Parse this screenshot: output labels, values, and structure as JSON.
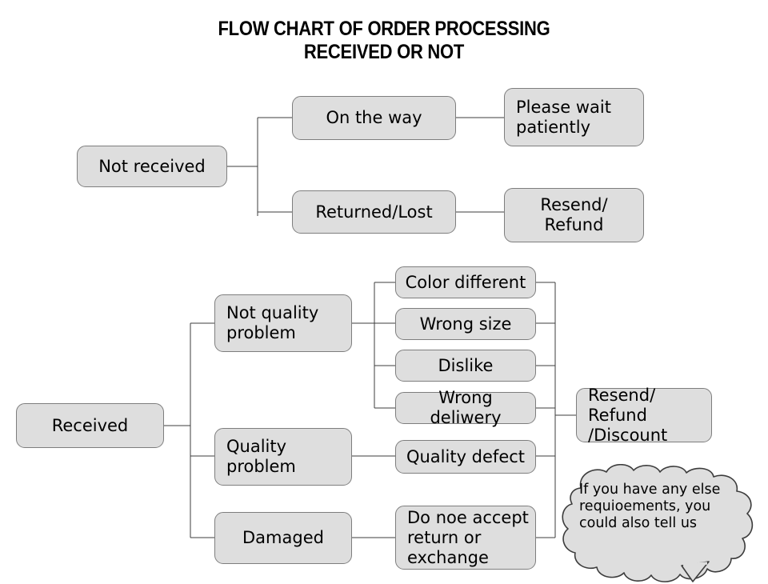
{
  "title": "FLOW CHART OF ORDER PROCESSING\nRECEIVED OR NOT",
  "colors": {
    "node_fill": "#dedede",
    "node_border": "#7e7e7e",
    "line": "#3c3c3c",
    "text": "#000000",
    "background": "#ffffff"
  },
  "chart_data": {
    "type": "diagram",
    "title": "FLOW CHART OF ORDER PROCESSING RECEIVED OR NOT",
    "diagram_kind": "flowchart-tree",
    "orientation": "left-to-right",
    "trees": [
      {
        "root": "Not received",
        "branches": [
          {
            "condition": "On the way",
            "outcome": "Please wait\npatiently"
          },
          {
            "condition": "Returned/Lost",
            "outcome": "Resend/\nRefund"
          }
        ]
      },
      {
        "root": "Received",
        "branches": [
          {
            "condition": "Not quality\nproblem",
            "reasons": [
              "Color different",
              "Wrong size",
              "Dislike",
              "Wrong deliwery"
            ],
            "outcome": "Resend/ Refund\n/Discount"
          },
          {
            "condition": "Quality\nproblem",
            "reasons": [
              "Quality defect"
            ],
            "outcome": "Resend/ Refund\n/Discount"
          },
          {
            "condition": "Damaged",
            "reasons": [
              "Do noe accept\nreturn or\nexchange"
            ],
            "outcome": "Resend/ Refund\n/Discount"
          }
        ]
      }
    ],
    "annotation": "If you have any else\nrequioements, you\ncould also tell us"
  },
  "nodes": {
    "not_received": {
      "label": "Not received"
    },
    "on_the_way": {
      "label": "On the way"
    },
    "please_wait": {
      "label": "Please wait\npatiently"
    },
    "returned_lost": {
      "label": "Returned/Lost"
    },
    "resend_refund": {
      "label": "Resend/\nRefund"
    },
    "received": {
      "label": "Received"
    },
    "not_quality": {
      "label": "Not quality\nproblem"
    },
    "quality_problem": {
      "label": "Quality\nproblem"
    },
    "damaged": {
      "label": "Damaged"
    },
    "color_different": {
      "label": "Color different"
    },
    "wrong_size": {
      "label": "Wrong size"
    },
    "dislike": {
      "label": "Dislike"
    },
    "wrong_delivery": {
      "label": "Wrong deliwery"
    },
    "quality_defect": {
      "label": "Quality defect"
    },
    "do_not_accept": {
      "label": "Do noe accept\nreturn or\nexchange"
    },
    "resend_discount": {
      "label": "Resend/ Refund\n/Discount"
    }
  },
  "callout": {
    "text": "If you have any else\nrequioements, you\ncould also tell us"
  }
}
